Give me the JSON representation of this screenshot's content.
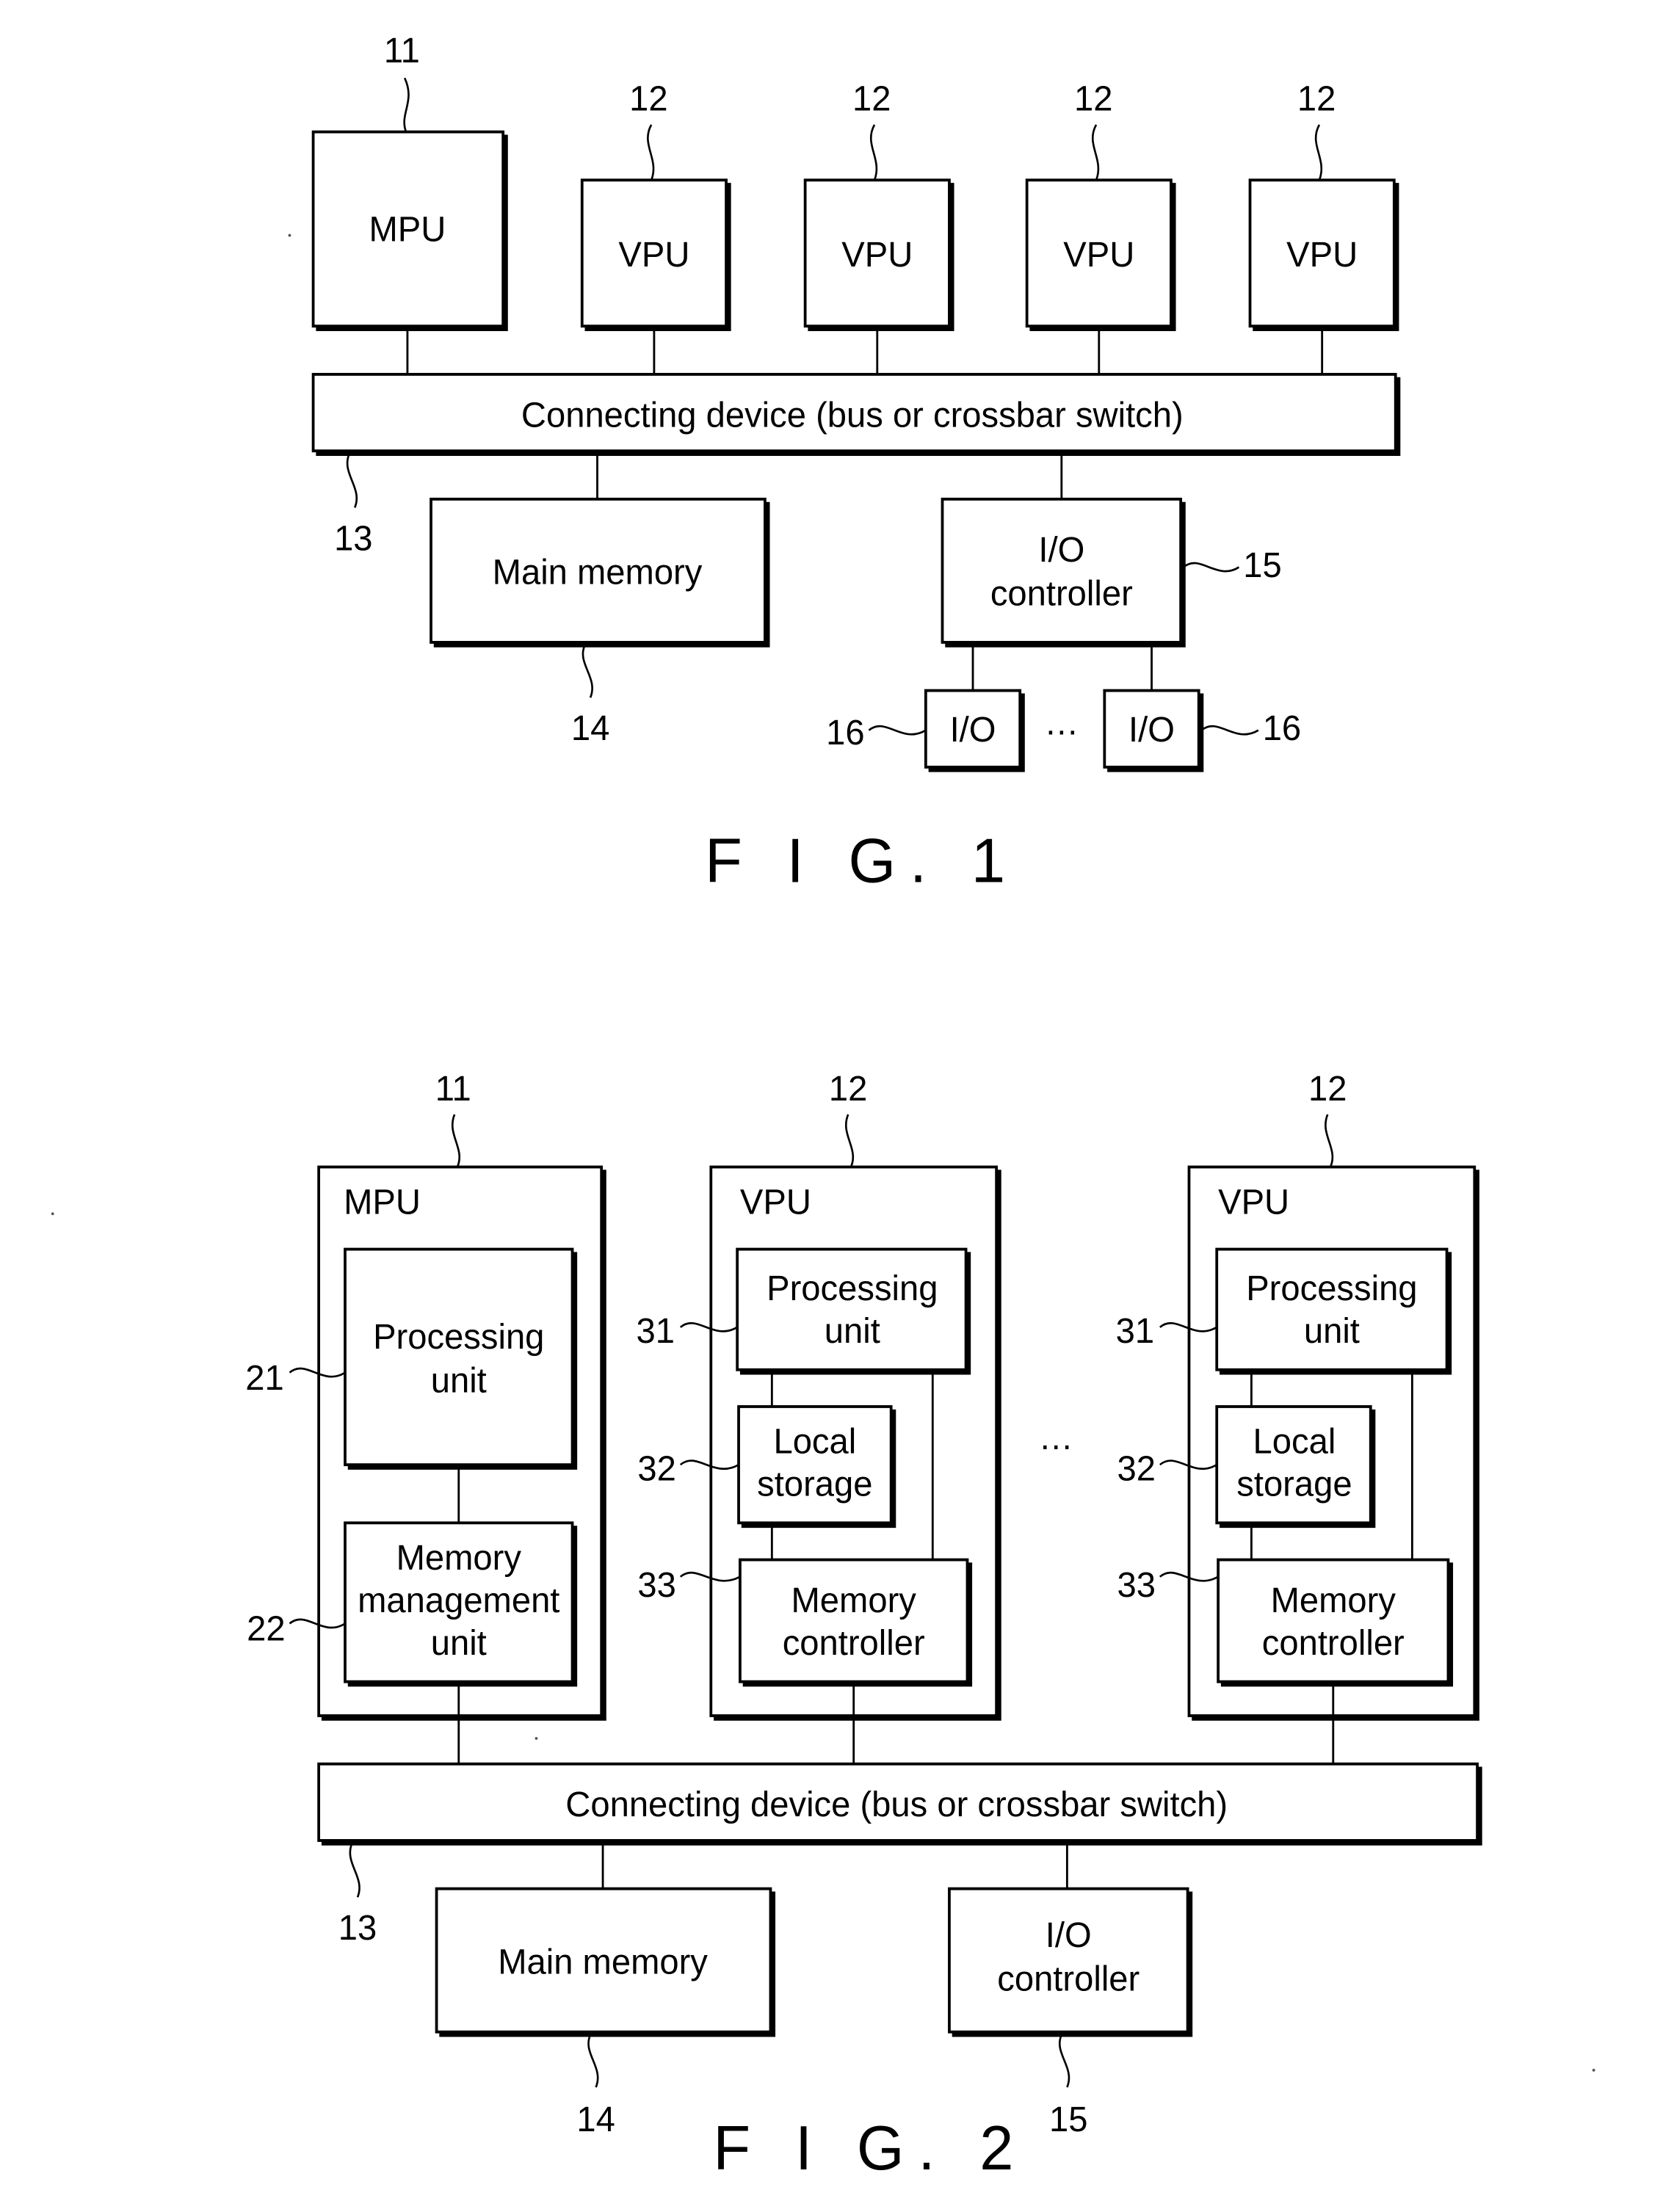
{
  "figures": {
    "fig1": {
      "caption": "F I G. 1",
      "mpu": {
        "label": "MPU",
        "ref": "11"
      },
      "vpus": [
        {
          "label": "VPU",
          "ref": "12"
        },
        {
          "label": "VPU",
          "ref": "12"
        },
        {
          "label": "VPU",
          "ref": "12"
        },
        {
          "label": "VPU",
          "ref": "12"
        }
      ],
      "connecting_device": {
        "label": "Connecting device (bus or crossbar switch)",
        "ref": "13"
      },
      "main_memory": {
        "label": "Main memory",
        "ref": "14"
      },
      "io_controller": {
        "line1": "I/O",
        "line2": "controller",
        "ref": "15"
      },
      "io_devices": [
        {
          "label": "I/O",
          "ref": "16"
        },
        {
          "label": "I/O",
          "ref": "16"
        }
      ],
      "ellipsis": "…"
    },
    "fig2": {
      "caption": "F I G. 2",
      "mpu": {
        "label": "MPU",
        "ref": "11",
        "processing_unit": {
          "line1": "Processing",
          "line2": "unit",
          "ref": "21"
        },
        "mmu": {
          "line1": "Memory",
          "line2": "management",
          "line3": "unit",
          "ref": "22"
        }
      },
      "vpus": [
        {
          "label": "VPU",
          "ref": "12",
          "processing_unit": {
            "line1": "Processing",
            "line2": "unit",
            "ref": "31"
          },
          "local_storage": {
            "line1": "Local",
            "line2": "storage",
            "ref": "32"
          },
          "memory_controller": {
            "line1": "Memory",
            "line2": "controller",
            "ref": "33"
          }
        },
        {
          "label": "VPU",
          "ref": "12",
          "processing_unit": {
            "line1": "Processing",
            "line2": "unit",
            "ref": "31"
          },
          "local_storage": {
            "line1": "Local",
            "line2": "storage",
            "ref": "32"
          },
          "memory_controller": {
            "line1": "Memory",
            "line2": "controller",
            "ref": "33"
          }
        }
      ],
      "ellipsis": "…",
      "connecting_device": {
        "label": "Connecting device (bus or crossbar switch)",
        "ref": "13"
      },
      "main_memory": {
        "label": "Main memory",
        "ref": "14"
      },
      "io_controller": {
        "line1": "I/O",
        "line2": "controller",
        "ref": "15"
      }
    }
  }
}
